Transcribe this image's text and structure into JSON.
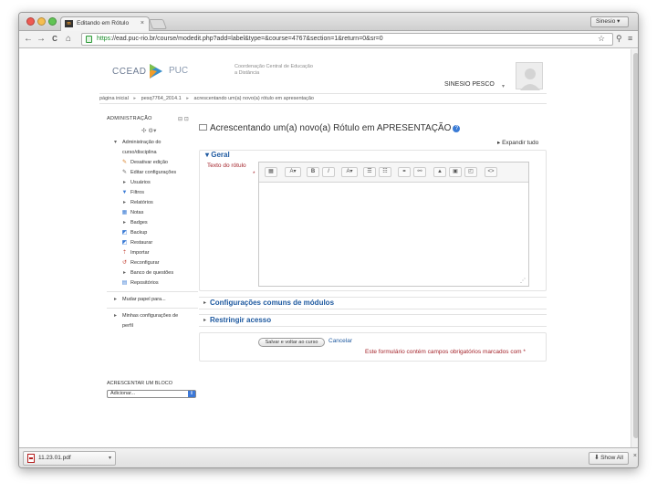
{
  "browser": {
    "tab_title": "Editando em Rótulo",
    "tab_close": "×",
    "favicon_text": "m",
    "user_button": "Sinesio",
    "user_caret": "▾",
    "back": "←",
    "forward": "→",
    "reload": "C",
    "home": "⌂",
    "url_scheme": "https",
    "url_rest": "://ead.puc-rio.br/course/modedit.php?add=label&type=&course=4767&section=1&return=0&sr=0",
    "star": "☆",
    "search": "⚲",
    "menu": "≡"
  },
  "header": {
    "logo_ccead": "CCEAD",
    "logo_puc": "PUC",
    "tagline": "Coordenação Central de Educação a Distância",
    "username": "SINESIO PESCO",
    "user_caret": "▾"
  },
  "breadcrumb": {
    "items": [
      "página inicial",
      "pesq7764_2014.1",
      "acrescentando um(a) novo(a) rótulo em apresentação"
    ],
    "separator": "▸"
  },
  "sidebar": {
    "admin_title": "ADMINISTRAÇÃO",
    "admin_controls": "⊟ ⊡",
    "gear_row": "✣ ⚙▾",
    "items": [
      {
        "icon": "▾",
        "label": "Administração do"
      },
      {
        "icon": "",
        "label": "curso/disciplina"
      },
      {
        "icon": "✎",
        "label": "Desativar edição"
      },
      {
        "icon": "✎",
        "label": "Editar configurações"
      },
      {
        "icon": "▸",
        "label": "Usuários"
      },
      {
        "icon": "▼",
        "label": "Filtros"
      },
      {
        "icon": "▸",
        "label": "Relatórios"
      },
      {
        "icon": "▦",
        "label": "Notas"
      },
      {
        "icon": "▸",
        "label": "Badges"
      },
      {
        "icon": "◩",
        "label": "Backup"
      },
      {
        "icon": "◩",
        "label": "Restaurar"
      },
      {
        "icon": "⇡",
        "label": "Importar"
      },
      {
        "icon": "↺",
        "label": "Reconfigurar"
      },
      {
        "icon": "▸",
        "label": "Banco de questões"
      },
      {
        "icon": "▤",
        "label": "Repositórios"
      }
    ],
    "switch_role": "Mudar papel para...",
    "my_profile_1": "Minhas configurações de",
    "my_profile_2": "perfil",
    "add_block_title": "ACRESCENTAR UM BLOCO",
    "add_select_value": "Adicionar...",
    "add_select_arrow": "⇕"
  },
  "main": {
    "title": "Acrescentando um(a) novo(a) Rótulo em APRESENTAÇÃO",
    "help": "?",
    "expand_all": "Expandir tudo",
    "expand_tri": "▸",
    "general_tri": "▾",
    "general_legend": "Geral",
    "field_label": "Texto do rótulo",
    "required_star": "*",
    "editor_buttons": [
      "▦",
      "A▾",
      "B",
      "I",
      "A▾",
      "☰",
      "☷",
      "⚭",
      "⚯",
      "▲",
      "▣",
      "◰",
      "<>"
    ],
    "editor_resize": "⋰",
    "section_common": "Configurações comuns de módulos",
    "section_restrict": "Restringir acesso",
    "section_tri": "▸",
    "save_button": "Salvar e voltar ao curso",
    "cancel": "Cancelar",
    "required_note": "Este formulário contém campos obrigatórios marcados com",
    "required_note_star": "*"
  },
  "downloads": {
    "file_name": "11.23.01.pdf",
    "file_caret": "▾",
    "show_all": "Show All",
    "show_all_icon": "⬇",
    "close": "×"
  },
  "colors": {
    "link_blue": "#1f5aa0",
    "required_red": "#a4242b",
    "secure_green": "#1a8c2a"
  }
}
